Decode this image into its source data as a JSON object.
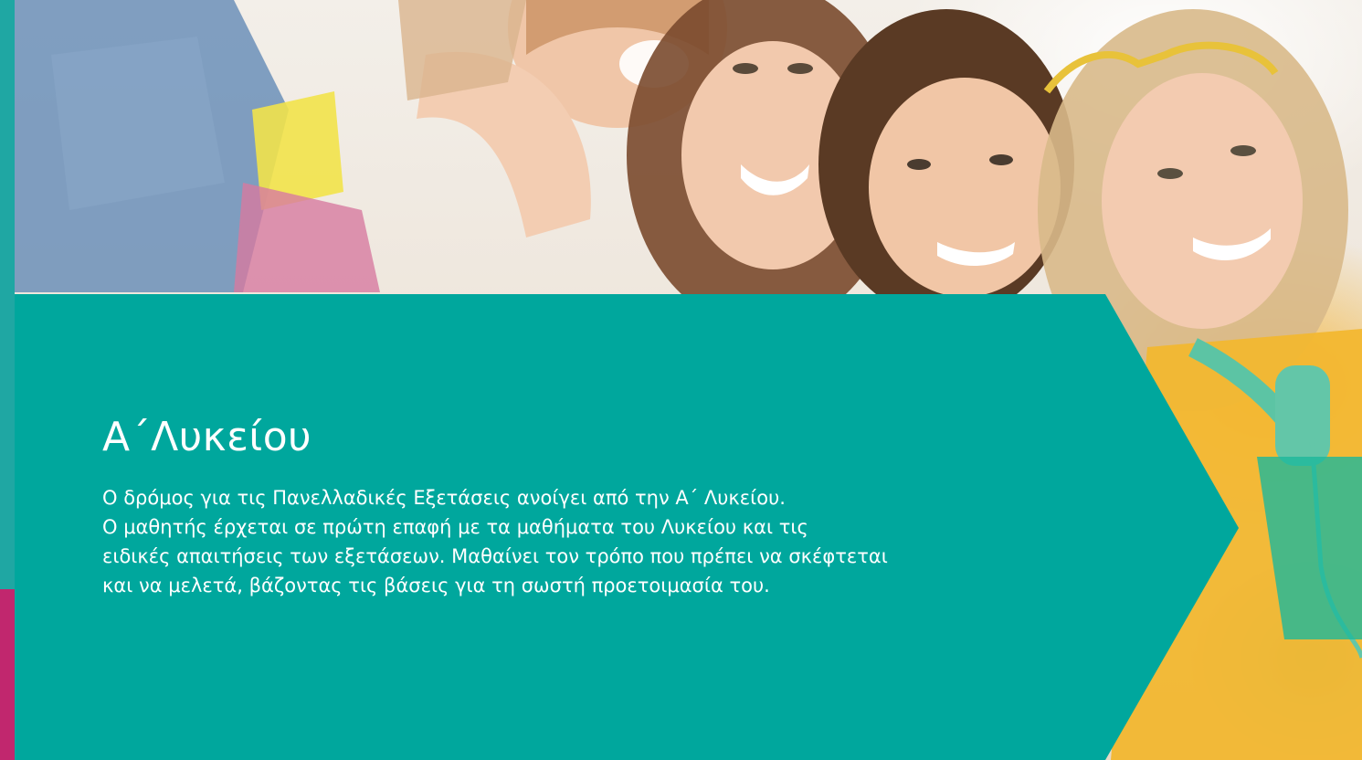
{
  "colors": {
    "panel_teal": "#00a79d",
    "stripe_teal": "#1fa7a3",
    "stripe_magenta": "#c1276e",
    "text": "#ffffff"
  },
  "hero": {
    "image_description_icon": "teenagers-smiling-photo"
  },
  "section": {
    "title": "Α΄Λυκείου",
    "paragraph": "Ο δρόμος για τις Πανελλαδικές Εξετάσεις ανοίγει από την Α΄ Λυκείου.\nΟ μαθητής έρχεται σε πρώτη επαφή με τα μαθήματα του Λυκείου και τις\nειδικές απαιτήσεις των εξετάσεων. Μαθαίνει τον τρόπο που πρέπει να σκέφτεται\nκαι να μελετά, βάζοντας τις βάσεις για τη σωστή προετοιμασία του."
  }
}
